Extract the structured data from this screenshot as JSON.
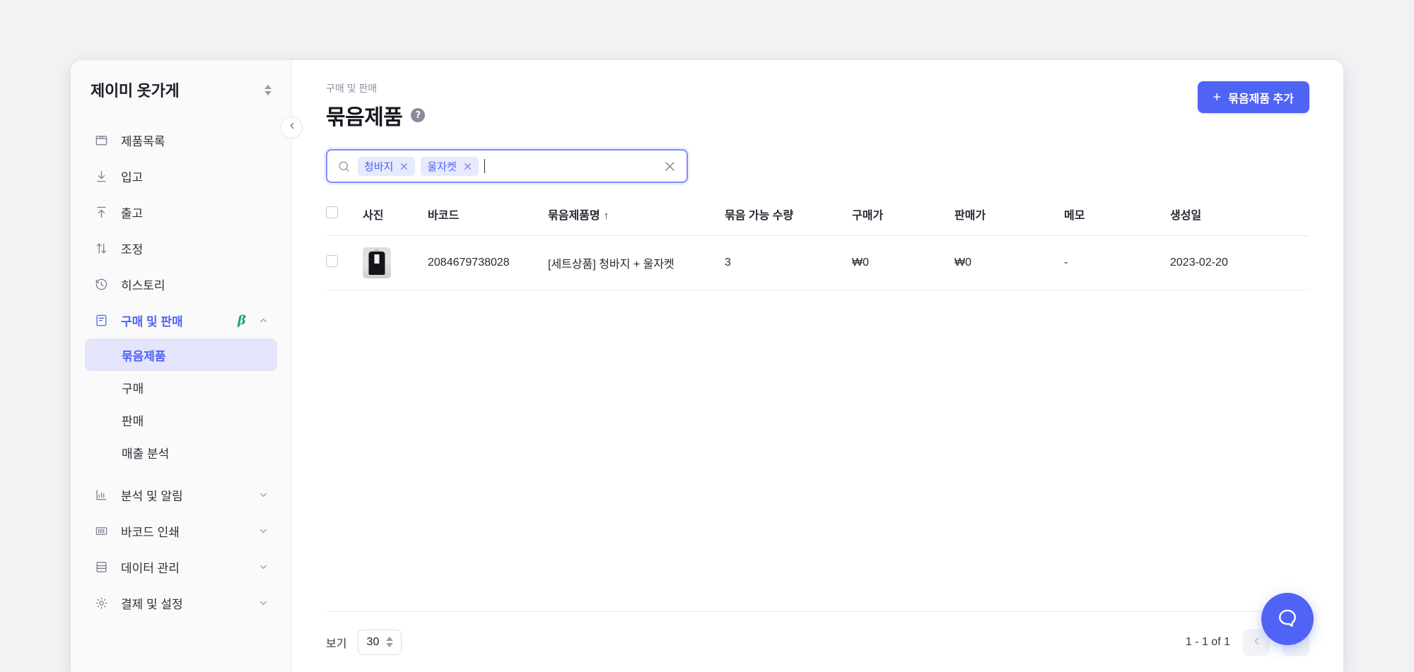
{
  "sidebar": {
    "workspace": "제이미 옷가게",
    "switcher_icon": "up-down-chevrons-icon",
    "items": [
      {
        "label": "제품목록",
        "icon": "box-icon"
      },
      {
        "label": "입고",
        "icon": "arrow-down-to-line-icon"
      },
      {
        "label": "출고",
        "icon": "arrow-up-from-line-icon"
      },
      {
        "label": "조정",
        "icon": "arrows-up-down-icon"
      },
      {
        "label": "히스토리",
        "icon": "history-clock-icon"
      }
    ],
    "section": {
      "label": "구매 및 판매",
      "icon": "list-document-icon",
      "beta": "β",
      "expanded": true,
      "children": [
        {
          "label": "묶음제품",
          "active": true
        },
        {
          "label": "구매",
          "active": false
        },
        {
          "label": "판매",
          "active": false
        },
        {
          "label": "매출 분석",
          "active": false
        }
      ]
    },
    "bottom_items": [
      {
        "label": "분석 및 알림",
        "icon": "bar-chart-icon"
      },
      {
        "label": "바코드 인쇄",
        "icon": "barcode-icon"
      },
      {
        "label": "데이터 관리",
        "icon": "database-icon"
      },
      {
        "label": "결제 및 설정",
        "icon": "gear-icon"
      }
    ],
    "collapse_icon": "chevron-left-icon"
  },
  "header": {
    "breadcrumb": "구매 및 판매",
    "title": "묶음제품",
    "help_glyph": "?",
    "add_button": {
      "plus": "+",
      "label": "묶음제품 추가"
    }
  },
  "search": {
    "icon": "search-icon",
    "tags": [
      "청바지",
      "울자켓"
    ],
    "tag_remove_icon": "close-icon",
    "clear_icon": "close-icon",
    "value": "",
    "placeholder": ""
  },
  "table": {
    "columns": [
      {
        "key": "checkbox",
        "label": ""
      },
      {
        "key": "photo",
        "label": "사진"
      },
      {
        "key": "barcode",
        "label": "바코드"
      },
      {
        "key": "name",
        "label": "묶음제품명",
        "sorted": "asc",
        "sort_glyph": "↑"
      },
      {
        "key": "qty",
        "label": "묶음 가능 수량"
      },
      {
        "key": "buy_price",
        "label": "구매가"
      },
      {
        "key": "sell_price",
        "label": "판매가"
      },
      {
        "key": "memo",
        "label": "메모"
      },
      {
        "key": "created",
        "label": "생성일"
      }
    ],
    "rows": [
      {
        "photo": "product-thumbnail",
        "barcode": "2084679738028",
        "name": "[세트상품] 청바지 + 울자켓",
        "qty": "3",
        "buy_price": "₩0",
        "sell_price": "₩0",
        "memo": "-",
        "created": "2023-02-20"
      }
    ]
  },
  "footer": {
    "per_page_label": "보기",
    "per_page_value": "30",
    "range_text": "1 - 1 of 1",
    "prev_icon": "chevron-left-icon",
    "next_icon": "chevron-right-icon"
  },
  "fab": {
    "icon": "chat-bubble-icon"
  },
  "colors": {
    "accent": "#4f63f5",
    "accent_soft": "#e4e5fb",
    "beta_green": "#17a673",
    "sidebar_bg": "#fafafb",
    "page_bg": "#f1f2f4"
  }
}
